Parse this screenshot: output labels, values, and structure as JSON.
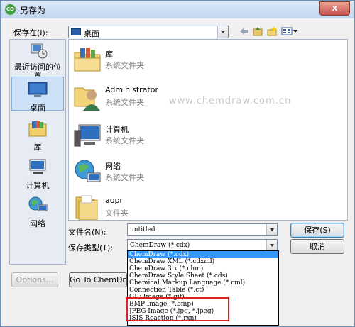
{
  "window": {
    "title": "另存为",
    "close_label": "x",
    "app_icon_label": "CD"
  },
  "toolbar": {
    "save_in_label": "保存在(I):",
    "save_in_value": "桌面"
  },
  "places": [
    {
      "label": "最近访问的位置"
    },
    {
      "label": "桌面"
    },
    {
      "label": "库"
    },
    {
      "label": "计算机"
    },
    {
      "label": "网络"
    }
  ],
  "files": [
    {
      "name": "库",
      "type": "系统文件夹"
    },
    {
      "name": "Administrator",
      "type": "系统文件夹"
    },
    {
      "name": "计算机",
      "type": "系统文件夹"
    },
    {
      "name": "网络",
      "type": "系统文件夹"
    },
    {
      "name": "aopr",
      "type": "文件夹"
    }
  ],
  "watermark": "www.chemdraw.com.cn",
  "form": {
    "filename_label": "文件名(N):",
    "filename_value": "untitled",
    "filetype_label": "保存类型(T):",
    "filetype_value": "ChemDraw (*.cdx)"
  },
  "buttons": {
    "save": "保存(S)",
    "cancel": "取消",
    "options": "Options...",
    "goto": "Go To ChemDraw"
  },
  "filetype_options": [
    "ChemDraw (*.cdx)",
    "ChemDraw XML (*.cdxml)",
    "ChemDraw 3.x (*.chm)",
    "ChemDraw Style Sheet (*.cds)",
    "Chemical Markup Language (*.cml)",
    "Connection Table (*.ct)",
    "GIF Image (*.gif)",
    "BMP Image (*.bmp)",
    "JPEG Image (*.jpg, *.jpeg)",
    "ISIS Reaction (*.rxn)"
  ],
  "colors": {
    "accent": "#3399ff",
    "highlight_box": "#e02020"
  }
}
